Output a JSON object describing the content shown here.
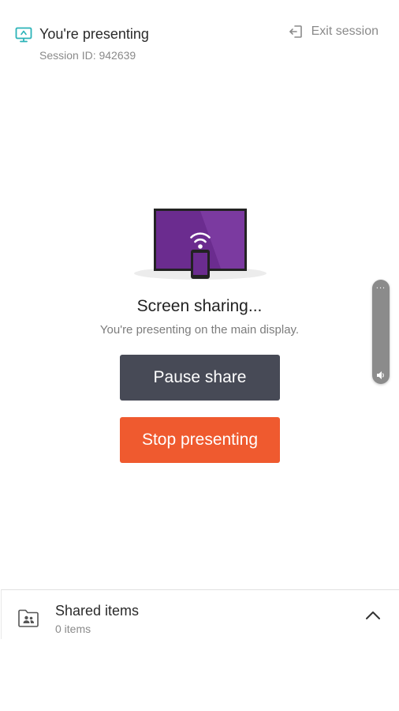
{
  "header": {
    "title": "You're presenting",
    "session_id": "Session ID: 942639",
    "exit_label": "Exit session",
    "icon": "present-icon",
    "exit_icon": "exit-icon"
  },
  "illustration": {
    "icon": "tv-cast-illustration",
    "screen_color": "#6b2c8f",
    "accent_color": "#7b3aa0"
  },
  "status": {
    "title": "Screen sharing...",
    "subtitle": "You're presenting on the main display."
  },
  "buttons": {
    "pause_label": "Pause share",
    "stop_label": "Stop presenting",
    "pause_color": "#474a56",
    "stop_color": "#ef5a2f"
  },
  "side_handle": {
    "menu_label": "...",
    "icon": "volume-icon"
  },
  "shared_items": {
    "title": "Shared items",
    "count": "0 items",
    "icon": "shared-folder-icon",
    "toggle_icon": "chevron-up-icon"
  }
}
